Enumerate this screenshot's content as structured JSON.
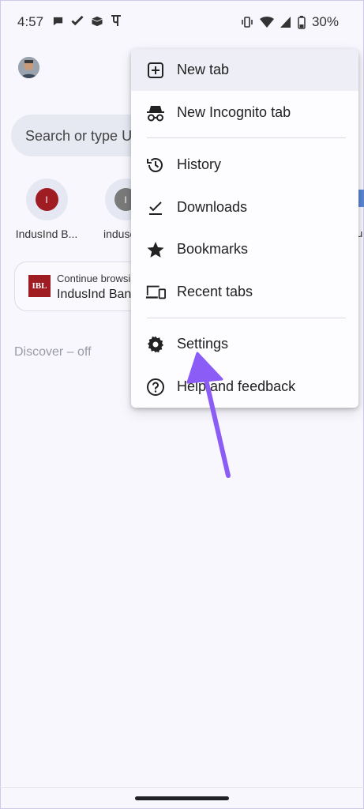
{
  "status_bar": {
    "time": "4:57",
    "notification_icons": [
      "chat-bubble-icon",
      "check-icon",
      "box-icon",
      "phonepe-icon"
    ],
    "system_icons": [
      "vibrate-icon",
      "wifi-icon",
      "signal-icon",
      "battery-icon"
    ],
    "battery_percent": "30%"
  },
  "page": {
    "search_placeholder": "Search or type URL",
    "shortcuts": [
      {
        "label": "IndusInd B...",
        "initial": "I",
        "color": "#9e1c22"
      },
      {
        "label": "induseas",
        "initial": "I",
        "color": "#7a7a7a"
      }
    ],
    "continue_card": {
      "subtitle": "Continue browsing",
      "title": "IndusInd Bank"
    },
    "logo_text": "IBL",
    "discover_label": "Discover – off",
    "edge_letter": "u"
  },
  "menu": {
    "items": [
      {
        "label": "New tab",
        "icon": "new-tab-icon"
      },
      {
        "label": "New Incognito tab",
        "icon": "incognito-icon"
      },
      {
        "label": "History",
        "icon": "history-icon"
      },
      {
        "label": "Downloads",
        "icon": "downloads-icon"
      },
      {
        "label": "Bookmarks",
        "icon": "star-icon"
      },
      {
        "label": "Recent tabs",
        "icon": "devices-icon"
      },
      {
        "label": "Settings",
        "icon": "gear-icon"
      },
      {
        "label": "Help and feedback",
        "icon": "help-icon"
      }
    ]
  },
  "colors": {
    "accent_arrow": "#8b5cf6",
    "menu_highlight": "#eeeff6",
    "background": "#f7f7fd"
  }
}
